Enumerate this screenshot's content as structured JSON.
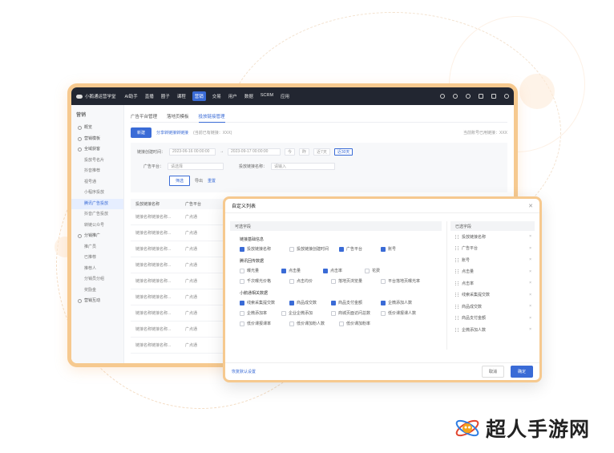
{
  "topbar": {
    "app_name": "小鹅通运营学堂",
    "nav": [
      "AI助手",
      "直播",
      "圈子",
      "课程",
      "营销",
      "交易",
      "用户",
      "数据",
      "SCRM",
      "应用"
    ],
    "active_nav": "营销"
  },
  "sidebar": {
    "title": "营销",
    "items": [
      {
        "label": "概览",
        "sub": false,
        "active": false
      },
      {
        "label": "营销模板",
        "sub": false,
        "active": false
      },
      {
        "label": "全域获客",
        "sub": false,
        "active": false
      },
      {
        "label": "投放号名片",
        "sub": true,
        "active": false
      },
      {
        "label": "抖音推荐",
        "sub": true,
        "active": false
      },
      {
        "label": "视号通",
        "sub": true,
        "active": false
      },
      {
        "label": "小程序投放",
        "sub": true,
        "active": false
      },
      {
        "label": "腾讯广告投放",
        "sub": true,
        "active": true
      },
      {
        "label": "抖音广告投放",
        "sub": true,
        "active": false
      },
      {
        "label": "转链公众号",
        "sub": true,
        "active": false
      },
      {
        "label": "分销推广",
        "sub": false,
        "active": false
      },
      {
        "label": "推广员",
        "sub": true,
        "active": false
      },
      {
        "label": "已推荐",
        "sub": true,
        "active": false
      },
      {
        "label": "推荐人",
        "sub": true,
        "active": false
      },
      {
        "label": "分销员分组",
        "sub": true,
        "active": false
      },
      {
        "label": "奖励金",
        "sub": true,
        "active": false
      },
      {
        "label": "营销互动",
        "sub": false,
        "active": false
      }
    ]
  },
  "main": {
    "tabs": [
      "广告平台管理",
      "落地页模板",
      "投放链接管理"
    ],
    "active_tab": "投放链接管理",
    "new_button": "新建",
    "ad_link_text": "分享转链接转链接",
    "ad_link_hint": "(当前已有链接：XXX)",
    "right_hint": "当前账号已用链接：XXX",
    "filters": {
      "created_label": "链接创建时间：",
      "date_from": "2023-06-16 00:00:00",
      "date_to": "2023-09-17 00:00:00",
      "quick": [
        "今",
        "昨",
        "近7天",
        "近30天"
      ],
      "platform_label": "广告平台：",
      "platform_placeholder": "请选择",
      "name_label": "投放链接名称：",
      "name_placeholder": "请输入",
      "search": "筛选",
      "export": "导出",
      "reset": "重置"
    },
    "table": {
      "headers": [
        "投放链接名称",
        "广告平台"
      ],
      "rows": [
        [
          "链接名称链接名称...",
          "广点通"
        ],
        [
          "链接名称链接名称...",
          "广点通"
        ],
        [
          "链接名称链接名称...",
          "广点通"
        ],
        [
          "链接名称链接名称...",
          "广点通"
        ],
        [
          "链接名称链接名称...",
          "广点通"
        ],
        [
          "链接名称链接名称...",
          "广点通"
        ],
        [
          "链接名称链接名称...",
          "广点通"
        ],
        [
          "链接名称链接名称...",
          "广点通"
        ],
        [
          "链接名称链接名称...",
          "广点通"
        ]
      ]
    }
  },
  "modal": {
    "title": "自定义列表",
    "available_header": "可选字段",
    "groups": [
      {
        "title": "链接基础信息",
        "options": [
          {
            "label": "投放链接名称",
            "checked": true
          },
          {
            "label": "投放链接创建时间",
            "checked": false
          },
          {
            "label": "广告平台",
            "checked": true
          },
          {
            "label": "账号",
            "checked": true
          }
        ]
      },
      {
        "title": "腾讯回传数据",
        "options": [
          {
            "label": "曝光量",
            "checked": false
          },
          {
            "label": "点击量",
            "checked": true
          },
          {
            "label": "点击率",
            "checked": true
          },
          {
            "label": "花费",
            "checked": false
          },
          {
            "label": "千次曝光价格",
            "checked": false
          },
          {
            "label": "点击均价",
            "checked": false
          },
          {
            "label": "落地页浏览量",
            "checked": false
          },
          {
            "label": "平台落地页曝光率",
            "checked": false
          }
        ]
      },
      {
        "title": "小鹅通相关数据",
        "options": [
          {
            "label": "线索采集提交数",
            "checked": true
          },
          {
            "label": "商品成交数",
            "checked": true
          },
          {
            "label": "商品支付金额",
            "checked": true
          },
          {
            "label": "企微添加人数",
            "checked": true
          },
          {
            "label": "企微添加率",
            "checked": false
          },
          {
            "label": "企业企微添加",
            "checked": false
          },
          {
            "label": "商城页面访问总数",
            "checked": false
          },
          {
            "label": "低价课报课人数",
            "checked": false
          },
          {
            "label": "低价课报课率",
            "checked": false
          },
          {
            "label": "低价课加粉人数",
            "checked": false
          },
          {
            "label": "低价课加粉率",
            "checked": false
          }
        ]
      }
    ],
    "selected_header": "已选字段",
    "selected": [
      "投放链接名称",
      "广告平台",
      "账号",
      "点击量",
      "点击率",
      "线索采集提交数",
      "商品成交数",
      "商品支付金额",
      "企微添加人数"
    ],
    "restore": "恢复默认设置",
    "cancel": "取消",
    "confirm": "确定"
  },
  "watermark": {
    "text": "超人手游网"
  },
  "colors": {
    "accent": "#3a6bd6",
    "frame": "#f6c98f",
    "topbar": "#222631"
  }
}
